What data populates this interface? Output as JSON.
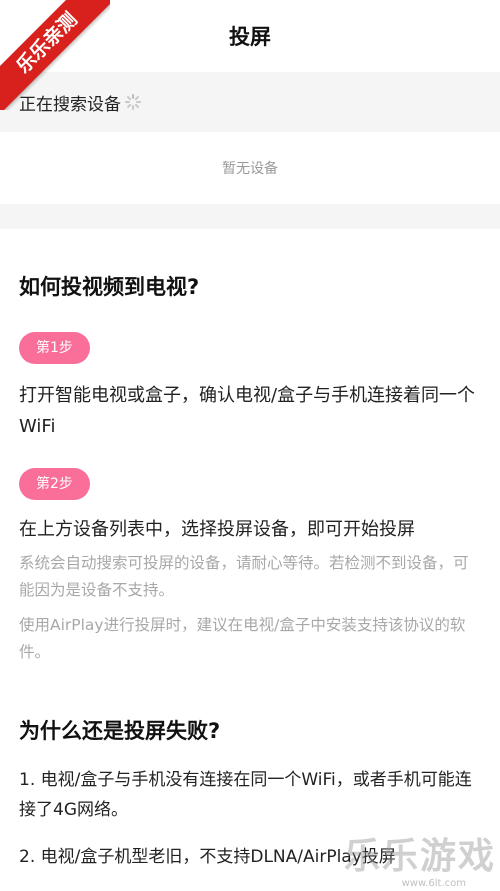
{
  "badge": {
    "text": "乐乐亲测"
  },
  "header": {
    "title": "投屏"
  },
  "search": {
    "status": "正在搜索设备"
  },
  "devices": {
    "empty": "暂无设备"
  },
  "howto": {
    "title": "如何投视频到电视?",
    "step1": {
      "badge": "第1步",
      "text": "打开智能电视或盒子，确认电视/盒子与手机连接着同一个WiFi"
    },
    "step2": {
      "badge": "第2步",
      "text": "在上方设备列表中，选择投屏设备，即可开始投屏",
      "note1": "系统会自动搜索可投屏的设备，请耐心等待。若检测不到设备，可能因为是设备不支持。",
      "note2": "使用AirPlay进行投屏时，建议在电视/盒子中安装支持该协议的软件。"
    }
  },
  "failure": {
    "title": "为什么还是投屏失败?",
    "items": [
      "1. 电视/盒子与手机没有连接在同一个WiFi，或者手机可能连接了4G网络。",
      "2. 电视/盒子机型老旧，不支持DLNA/AirPlay投屏"
    ]
  },
  "watermark": {
    "text": "乐乐游戏",
    "url": "www.6lt.com"
  }
}
